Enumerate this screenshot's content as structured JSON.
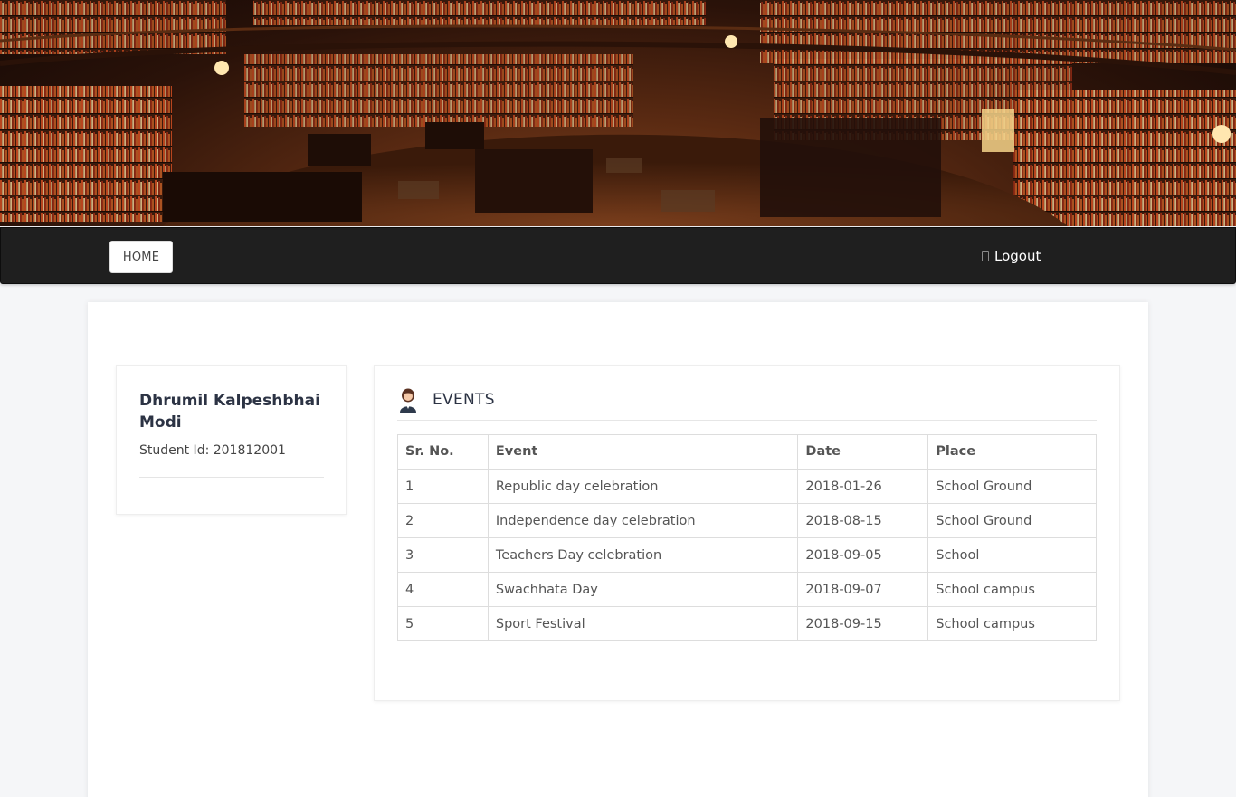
{
  "nav": {
    "home_label": "HOME",
    "logout_label": "Logout"
  },
  "profile": {
    "name": "Dhrumil Kalpeshbhai Modi",
    "student_id_text": "Student Id: 201812001"
  },
  "events": {
    "title": "EVENTS",
    "columns": [
      "Sr. No.",
      "Event",
      "Date",
      "Place"
    ],
    "rows": [
      [
        "1",
        "Republic day celebration",
        "2018-01-26",
        "School Ground"
      ],
      [
        "2",
        "Independence day celebration",
        "2018-08-15",
        "School Ground"
      ],
      [
        "3",
        "Teachers Day celebration",
        "2018-09-05",
        "School"
      ],
      [
        "4",
        "Swachhata Day",
        "2018-09-07",
        "School campus"
      ],
      [
        "5",
        "Sport Festival",
        "2018-09-15",
        "School campus"
      ]
    ]
  },
  "colors": {
    "navbar_bg": "#1f1f1f",
    "page_bg": "#f5f6f8",
    "card_bg": "#ffffff"
  },
  "icons": {
    "events_icon": "student-avatar-icon",
    "logout_icon": "logout-icon"
  }
}
